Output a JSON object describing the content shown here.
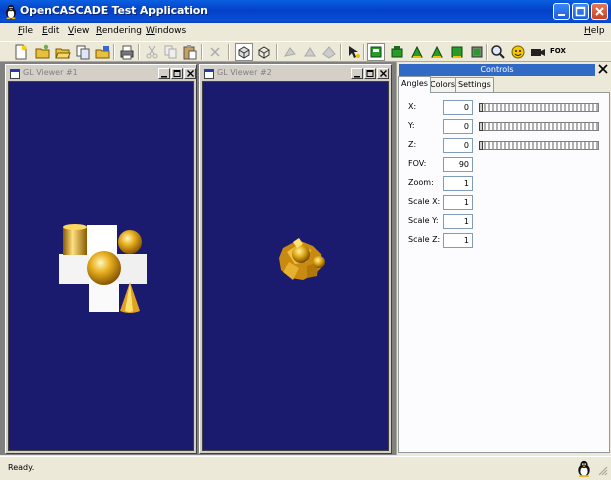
{
  "window": {
    "title": "OpenCASCADE Test Application"
  },
  "menu": {
    "file": {
      "label": "File",
      "accel": "F",
      "rest": "ile"
    },
    "edit": {
      "label": "Edit",
      "accel": "E",
      "rest": "dit"
    },
    "view": {
      "label": "View",
      "accel": "V",
      "rest": "iew"
    },
    "rendering": {
      "label": "Rendering",
      "accel": "R",
      "rest": "endering"
    },
    "windows": {
      "label": "Windows",
      "accel": "W",
      "rest": "indows"
    },
    "help": {
      "label": "Help",
      "accel": "H",
      "rest": "elp"
    }
  },
  "toolbar": {
    "icons": [
      "new-icon",
      "open-icon",
      "open-folder-icon",
      "copy-files-icon",
      "save-icon",
      "print-icon",
      "cut-icon",
      "copy-icon",
      "paste-icon",
      "delete-icon",
      "shaded-mode-icon",
      "wireframe-mode-icon",
      "gray-shape-1-icon",
      "gray-shape-2-icon",
      "gray-shape-3-icon",
      "pointer-tool-icon",
      "green-box-1-icon",
      "green-box-2-icon",
      "green-box-3-icon",
      "green-box-4-icon",
      "green-box-5-icon",
      "green-box-6-icon",
      "zoom-icon",
      "smiley-icon",
      "camera-icon"
    ],
    "fox_label": "FOX"
  },
  "viewers": [
    {
      "title": "GL Viewer #1"
    },
    {
      "title": "GL Viewer #2"
    }
  ],
  "controls": {
    "title": "Controls",
    "tabs": [
      "Angles",
      "Colors",
      "Settings"
    ],
    "active_tab": "Angles",
    "fields": [
      {
        "label": "X:",
        "value": "0",
        "slider": true
      },
      {
        "label": "Y:",
        "value": "0",
        "slider": true
      },
      {
        "label": "Z:",
        "value": "0",
        "slider": true
      },
      {
        "label": "FOV:",
        "value": "90",
        "slider": false
      },
      {
        "label": "Zoom:",
        "value": "1",
        "slider": false
      },
      {
        "label": "Scale X:",
        "value": "1",
        "slider": false
      },
      {
        "label": "Scale Y:",
        "value": "1",
        "slider": false
      },
      {
        "label": "Scale Z:",
        "value": "1",
        "slider": false
      }
    ]
  },
  "status": {
    "text": "Ready."
  },
  "colors": {
    "viewport_background": "#1a1a6e",
    "object_gold": "#e8a820",
    "object_white": "#ffffff",
    "title_bar_blue": "#0a5fe0"
  }
}
